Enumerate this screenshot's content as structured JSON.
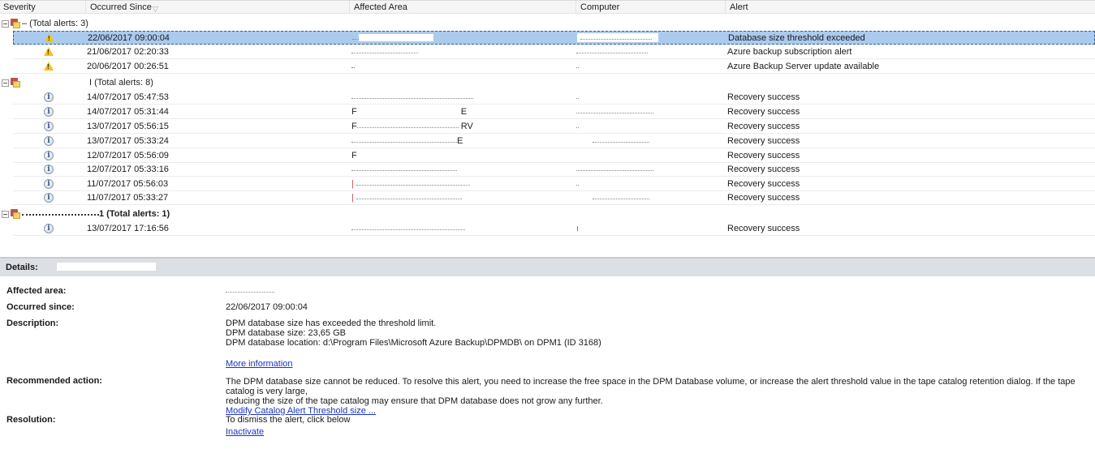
{
  "grid": {
    "columns": {
      "severity": "Severity",
      "occurred_since": "Occurred Since",
      "affected_area": "Affected Area",
      "computer": "Computer",
      "alert": "Alert"
    },
    "sort_indicator": "▽",
    "groups": [
      {
        "label": "– (Total alerts: 3)",
        "alerts": [
          {
            "severity": "warning",
            "occurred_since": "22/06/2017 09:00:04",
            "alert": "Database size threshold exceeded",
            "selected": true
          },
          {
            "severity": "warning",
            "occurred_since": "21/06/2017 02:20:33",
            "alert": "Azure backup subscription alert"
          },
          {
            "severity": "warning",
            "occurred_since": "20/06/2017 00:26:51",
            "alert": "Azure Backup Server update available"
          }
        ]
      },
      {
        "label": "I (Total alerts: 8)",
        "alerts": [
          {
            "severity": "info",
            "occurred_since": "14/07/2017 05:47:53",
            "area_partial": "",
            "alert": "Recovery success"
          },
          {
            "severity": "info",
            "occurred_since": "14/07/2017 05:31:44",
            "area_partial": "F",
            "area_suffix": "E",
            "alert": "Recovery success"
          },
          {
            "severity": "info",
            "occurred_since": "13/07/2017 05:56:15",
            "area_partial": "F",
            "area_suffix": "RV",
            "alert": "Recovery success"
          },
          {
            "severity": "info",
            "occurred_since": "13/07/2017 05:33:24",
            "area_partial": "",
            "area_suffix": "E",
            "alert": "Recovery success"
          },
          {
            "severity": "info",
            "occurred_since": "12/07/2017 05:56:09",
            "area_partial": "F",
            "alert": "Recovery success"
          },
          {
            "severity": "info",
            "occurred_since": "12/07/2017 05:33:16",
            "area_partial": "",
            "alert": "Recovery success"
          },
          {
            "severity": "info",
            "occurred_since": "11/07/2017 05:56:03",
            "area_partial": "",
            "alert": "Recovery success"
          },
          {
            "severity": "info",
            "occurred_since": "11/07/2017 05:33:27",
            "area_partial": "",
            "alert": "Recovery success"
          }
        ]
      },
      {
        "label": "1 (Total alerts: 1)",
        "alerts": [
          {
            "severity": "info",
            "occurred_since": "13/07/2017 17:16:56",
            "alert": "Recovery success"
          }
        ]
      }
    ]
  },
  "details": {
    "header_label": "Details:",
    "labels": {
      "affected_area": "Affected area:",
      "occurred_since": "Occurred since:",
      "description": "Description:",
      "recommended_action": "Recommended action:",
      "resolution": "Resolution:"
    },
    "occurred_since": "22/06/2017 09:00:04",
    "description_lines": [
      "DPM database size has exceeded the threshold limit.",
      "DPM database size: 23,65 GB",
      "DPM database location: d:\\Program Files\\Microsoft Azure Backup\\DPMDB\\ on DPM1 (ID 3168)"
    ],
    "more_information_link": "More information",
    "recommended_action_lines": [
      "The DPM database size cannot be reduced. To resolve this alert, you need to increase the free space in the DPM Database volume, or increase the alert threshold value in the tape catalog retention dialog. If the tape catalog is very large,",
      "reducing the size of the tape catalog may ensure that DPM database does not grow any further."
    ],
    "modify_threshold_link": "Modify Catalog Alert Threshold size ...",
    "resolution_text": "To dismiss the alert, click below",
    "inactivate_link": "Inactivate"
  }
}
